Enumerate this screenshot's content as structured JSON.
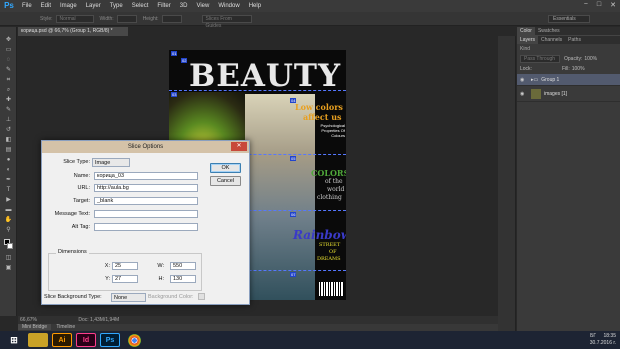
{
  "app": {
    "logo": "Ps"
  },
  "menu": [
    "File",
    "Edit",
    "Image",
    "Layer",
    "Type",
    "Select",
    "Filter",
    "3D",
    "View",
    "Window",
    "Help"
  ],
  "window_controls": [
    "−",
    "□",
    "✕"
  ],
  "options_bar": {
    "style_label": "Style:",
    "style_value": "Normal",
    "width_label": "Width:",
    "height_label": "Height:",
    "guides_button": "Slices From Guides",
    "workspace": "Essentials"
  },
  "document_tab": {
    "title": "корица.psd @ 66,7% (Group 1, RGB/8) *"
  },
  "magazine": {
    "title": "BEAUTY",
    "headline1": "Low colors",
    "headline2": "affect us",
    "sub": "Psychological Properties Of Colours",
    "colors": "COLORS",
    "of_the": "of the",
    "world": "world",
    "clothing": "clothing",
    "rainbow": "Rainbow",
    "street": "STREET",
    "of": "OF",
    "dreams": "DREAMS",
    "slice_badges": [
      "01",
      "02",
      "03",
      "04",
      "05",
      "06",
      "07",
      "08",
      "09",
      "10",
      "11",
      "12",
      "13"
    ]
  },
  "status_bar": {
    "zoom": "66,67%",
    "doc": "Doc: 1,43M/1,94M"
  },
  "bottom_tabs": [
    "Mini Bridge",
    "Timeline"
  ],
  "panels": {
    "color_tabs": [
      "Color",
      "Swatches"
    ],
    "layers_tabs": [
      "Layers",
      "Channels",
      "Paths"
    ],
    "blend_mode": "Pass Through",
    "opacity_label": "Opacity:",
    "opacity_value": "100%",
    "lock_label": "Lock:",
    "fill_label": "Fill:",
    "fill_value": "100%",
    "kind_label": "Kind",
    "layers": [
      {
        "name": "Group 1",
        "selected": true
      },
      {
        "name": "images [1]",
        "selected": false
      }
    ]
  },
  "dialog": {
    "title": "Slice Options",
    "slice_type_label": "Slice Type:",
    "slice_type_value": "Image",
    "name_label": "Name:",
    "name_value": "корица_03",
    "url_label": "URL:",
    "url_value": "http://aula.bg",
    "target_label": "Target:",
    "target_value": "_blank",
    "message_label": "Message Text:",
    "message_value": "",
    "alt_label": "Alt Tag:",
    "alt_value": "",
    "dimensions_title": "Dimensions",
    "x_label": "X:",
    "x_value": "25",
    "y_label": "Y:",
    "y_value": "27",
    "w_label": "W:",
    "w_value": "550",
    "h_label": "H:",
    "h_value": "130",
    "bg_type_label": "Slice Background Type:",
    "bg_type_value": "None",
    "bg_color_label": "Background Color:",
    "ok": "OK",
    "cancel": "Cancel",
    "close": "✕"
  },
  "taskbar": {
    "apps": [
      "",
      "Ai",
      "Id",
      "Ps",
      ""
    ],
    "language": "БГ",
    "time": "18:35",
    "date": "30.7.2016 г."
  }
}
